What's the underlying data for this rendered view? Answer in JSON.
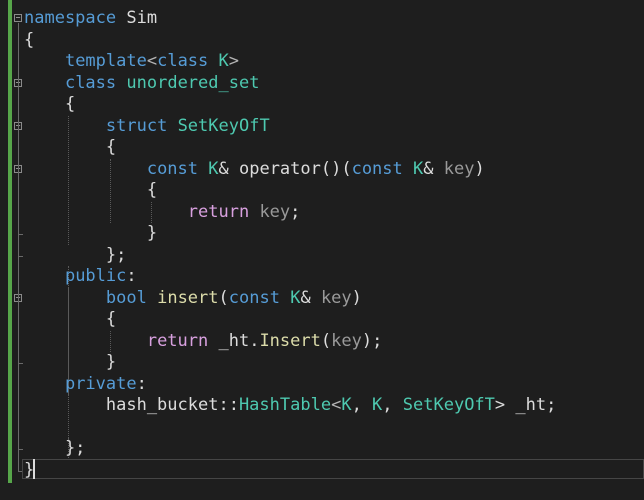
{
  "editor": {
    "language": "C++",
    "colors": {
      "background": "#1e1e1e",
      "keyword": "#569cd6",
      "type": "#4ec9b0",
      "function": "#dcdcaa",
      "control_keyword": "#d8a0df",
      "parameter": "#9a9a9a",
      "change_bar": "#57a64a"
    },
    "lines": [
      {
        "tokens": [
          {
            "t": "namespace",
            "c": "k"
          },
          {
            "t": " Sim",
            "c": "tx"
          }
        ]
      },
      {
        "tokens": [
          {
            "t": "{",
            "c": "tx"
          }
        ]
      },
      {
        "tokens": [
          {
            "t": "    ",
            "c": "tx"
          },
          {
            "t": "template",
            "c": "k"
          },
          {
            "t": "<",
            "c": "pu"
          },
          {
            "t": "class",
            "c": "k"
          },
          {
            "t": " ",
            "c": "tx"
          },
          {
            "t": "K",
            "c": "ty"
          },
          {
            "t": ">",
            "c": "pu"
          }
        ]
      },
      {
        "tokens": [
          {
            "t": "    ",
            "c": "tx"
          },
          {
            "t": "class",
            "c": "k"
          },
          {
            "t": " ",
            "c": "tx"
          },
          {
            "t": "unordered_set",
            "c": "ty"
          }
        ]
      },
      {
        "tokens": [
          {
            "t": "    {",
            "c": "tx"
          }
        ]
      },
      {
        "tokens": [
          {
            "t": "        ",
            "c": "tx"
          },
          {
            "t": "struct",
            "c": "k"
          },
          {
            "t": " ",
            "c": "tx"
          },
          {
            "t": "SetKeyOfT",
            "c": "ty"
          }
        ]
      },
      {
        "tokens": [
          {
            "t": "        {",
            "c": "tx"
          }
        ]
      },
      {
        "tokens": [
          {
            "t": "            ",
            "c": "tx"
          },
          {
            "t": "const",
            "c": "k"
          },
          {
            "t": " ",
            "c": "tx"
          },
          {
            "t": "K",
            "c": "ty"
          },
          {
            "t": "& operator()(",
            "c": "tx"
          },
          {
            "t": "const",
            "c": "k"
          },
          {
            "t": " ",
            "c": "tx"
          },
          {
            "t": "K",
            "c": "ty"
          },
          {
            "t": "& ",
            "c": "tx"
          },
          {
            "t": "key",
            "c": "pa"
          },
          {
            "t": ")",
            "c": "tx"
          }
        ]
      },
      {
        "tokens": [
          {
            "t": "            {",
            "c": "tx"
          }
        ]
      },
      {
        "tokens": [
          {
            "t": "                ",
            "c": "tx"
          },
          {
            "t": "return",
            "c": "kw"
          },
          {
            "t": " ",
            "c": "tx"
          },
          {
            "t": "key",
            "c": "pa"
          },
          {
            "t": ";",
            "c": "tx"
          }
        ]
      },
      {
        "tokens": [
          {
            "t": "            }",
            "c": "tx"
          }
        ]
      },
      {
        "tokens": [
          {
            "t": "        };",
            "c": "tx"
          }
        ]
      },
      {
        "tokens": [
          {
            "t": "    ",
            "c": "tx"
          },
          {
            "t": "public",
            "c": "k"
          },
          {
            "t": ":",
            "c": "tx"
          }
        ]
      },
      {
        "tokens": [
          {
            "t": "        ",
            "c": "tx"
          },
          {
            "t": "bool",
            "c": "k"
          },
          {
            "t": " ",
            "c": "tx"
          },
          {
            "t": "insert",
            "c": "fn"
          },
          {
            "t": "(",
            "c": "tx"
          },
          {
            "t": "const",
            "c": "k"
          },
          {
            "t": " ",
            "c": "tx"
          },
          {
            "t": "K",
            "c": "ty"
          },
          {
            "t": "& ",
            "c": "tx"
          },
          {
            "t": "key",
            "c": "pa"
          },
          {
            "t": ")",
            "c": "tx"
          }
        ]
      },
      {
        "tokens": [
          {
            "t": "        {",
            "c": "tx"
          }
        ]
      },
      {
        "tokens": [
          {
            "t": "            ",
            "c": "tx"
          },
          {
            "t": "return",
            "c": "kw"
          },
          {
            "t": " _ht.",
            "c": "tx"
          },
          {
            "t": "Insert",
            "c": "fn"
          },
          {
            "t": "(",
            "c": "tx"
          },
          {
            "t": "key",
            "c": "pa"
          },
          {
            "t": ");",
            "c": "tx"
          }
        ]
      },
      {
        "tokens": [
          {
            "t": "        }",
            "c": "tx"
          }
        ]
      },
      {
        "tokens": [
          {
            "t": "    ",
            "c": "tx"
          },
          {
            "t": "private",
            "c": "k"
          },
          {
            "t": ":",
            "c": "tx"
          }
        ]
      },
      {
        "tokens": [
          {
            "t": "        hash_bucket::",
            "c": "tx"
          },
          {
            "t": "HashTable",
            "c": "ty"
          },
          {
            "t": "<",
            "c": "pu"
          },
          {
            "t": "K",
            "c": "ty"
          },
          {
            "t": ", ",
            "c": "tx"
          },
          {
            "t": "K",
            "c": "ty"
          },
          {
            "t": ", ",
            "c": "tx"
          },
          {
            "t": "SetKeyOfT",
            "c": "ty"
          },
          {
            "t": "> _ht;",
            "c": "tx"
          }
        ]
      },
      {
        "tokens": [
          {
            "t": "",
            "c": "tx"
          }
        ]
      },
      {
        "tokens": [
          {
            "t": "    };",
            "c": "tx"
          }
        ]
      },
      {
        "tokens": [
          {
            "t": "}",
            "c": "tx"
          }
        ]
      }
    ],
    "fold_markers": [
      0,
      3,
      5,
      7,
      13
    ]
  }
}
